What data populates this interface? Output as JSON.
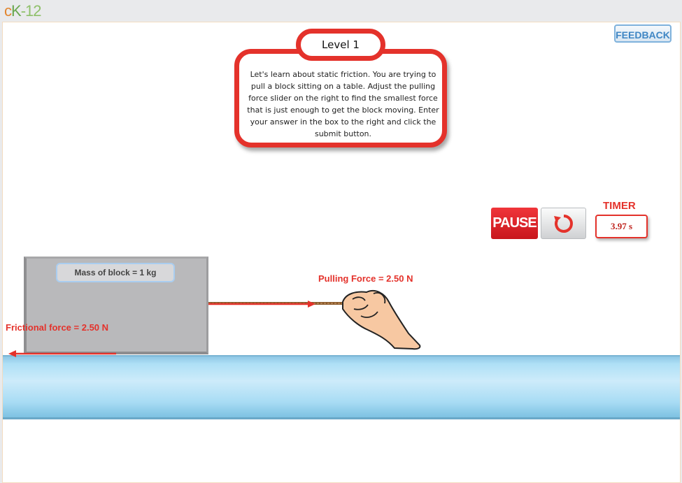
{
  "header": {
    "logo": {
      "c": "c",
      "k": "K",
      "n": "-12"
    }
  },
  "feedback_label": "FEEDBACK",
  "level": {
    "title": "Level 1",
    "instructions": "Let's learn about static friction. You are trying to pull a block sitting on a table. Adjust the pulling force slider on the right to find the smallest force that is just enough to get the block moving. Enter your answer in the box to the right and click the submit button."
  },
  "controls": {
    "pause_label": "PAUSE",
    "reset_icon": "reset-icon"
  },
  "timer": {
    "label": "TIMER",
    "value": "3.97 s"
  },
  "simulation": {
    "mass_label": "Mass of block = 1 kg",
    "pulling_force_label": "Pulling Force = 2.50 N",
    "frictional_force_label": "Frictional force = 2.50 N"
  },
  "colors": {
    "accent_red": "#e4322b",
    "table_blue": "#aee0f6",
    "block_gray": "#b9b9bb"
  }
}
